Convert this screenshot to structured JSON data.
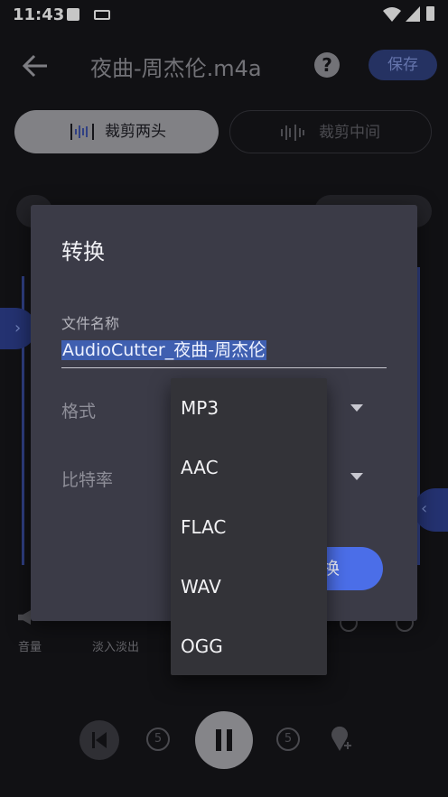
{
  "status_bar": {
    "time": "11:43"
  },
  "header": {
    "title": "夜曲-周杰伦.m4a",
    "save_label": "保存"
  },
  "modes": {
    "trim_ends": "裁剪两头",
    "trim_middle": "裁剪中间"
  },
  "tools": {
    "volume": "音量",
    "fade": "淡入淡出"
  },
  "dialog": {
    "title": "转换",
    "filename_label": "文件名称",
    "filename_value": "AudioCutter_夜曲-周杰伦",
    "format_label": "格式",
    "bitrate_label": "比特率",
    "convert_label": "转换"
  },
  "dropdown": {
    "options": [
      "MP3",
      "AAC",
      "FLAC",
      "WAV",
      "OGG"
    ]
  },
  "player": {
    "rewind_seconds": "5",
    "forward_seconds": "5"
  },
  "colors": {
    "accent": "#4b6ee8",
    "dialog_bg": "#3b3b47",
    "menu_bg": "#333338"
  }
}
